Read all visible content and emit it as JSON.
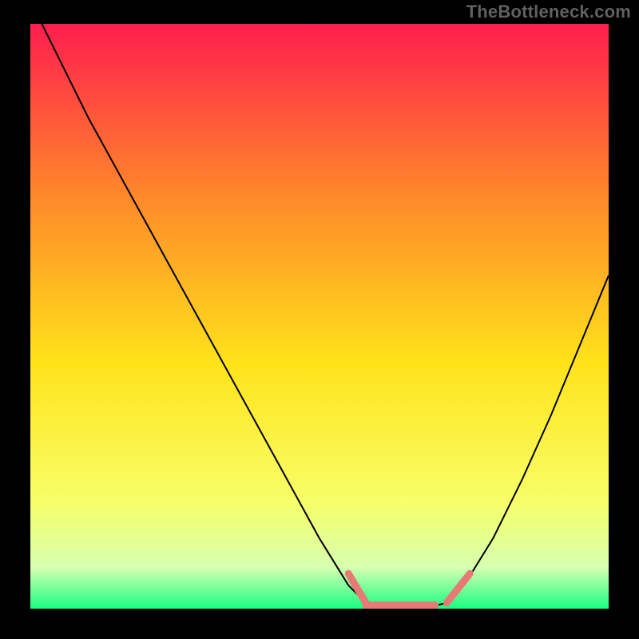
{
  "watermark": "TheBottleneck.com",
  "colors": {
    "background": "#000000",
    "gradient_top": "#ff1e4e",
    "gradient_upper_mid": "#ff8a2a",
    "gradient_mid": "#ffe31a",
    "gradient_lower_mid": "#f7ff6a",
    "gradient_low": "#d6ffb0",
    "gradient_bottom": "#18ff82",
    "curve": "#000000",
    "marker": "#e77a74"
  },
  "chart_data": {
    "type": "line",
    "title": "",
    "xlabel": "",
    "ylabel": "",
    "xlim": [
      0,
      100
    ],
    "ylim": [
      0,
      100
    ],
    "series": [
      {
        "name": "bottleneck-curve",
        "x": [
          2,
          10,
          20,
          30,
          40,
          50,
          55,
          58,
          60,
          64,
          68,
          72,
          75,
          80,
          85,
          90,
          95,
          100
        ],
        "values": [
          100,
          84,
          66,
          48,
          30,
          12,
          4,
          1,
          0,
          0,
          0,
          1,
          4,
          12,
          22,
          33,
          45,
          57
        ]
      }
    ],
    "annotations": [
      {
        "name": "marker-left-slope",
        "type": "segment",
        "x0": 55,
        "y0": 6,
        "x1": 58,
        "y1": 1
      },
      {
        "name": "marker-flat",
        "type": "segment",
        "x0": 58,
        "y0": 0.6,
        "x1": 70,
        "y1": 0.6
      },
      {
        "name": "marker-right-slope",
        "type": "segment",
        "x0": 72,
        "y0": 1,
        "x1": 76,
        "y1": 6
      }
    ]
  }
}
